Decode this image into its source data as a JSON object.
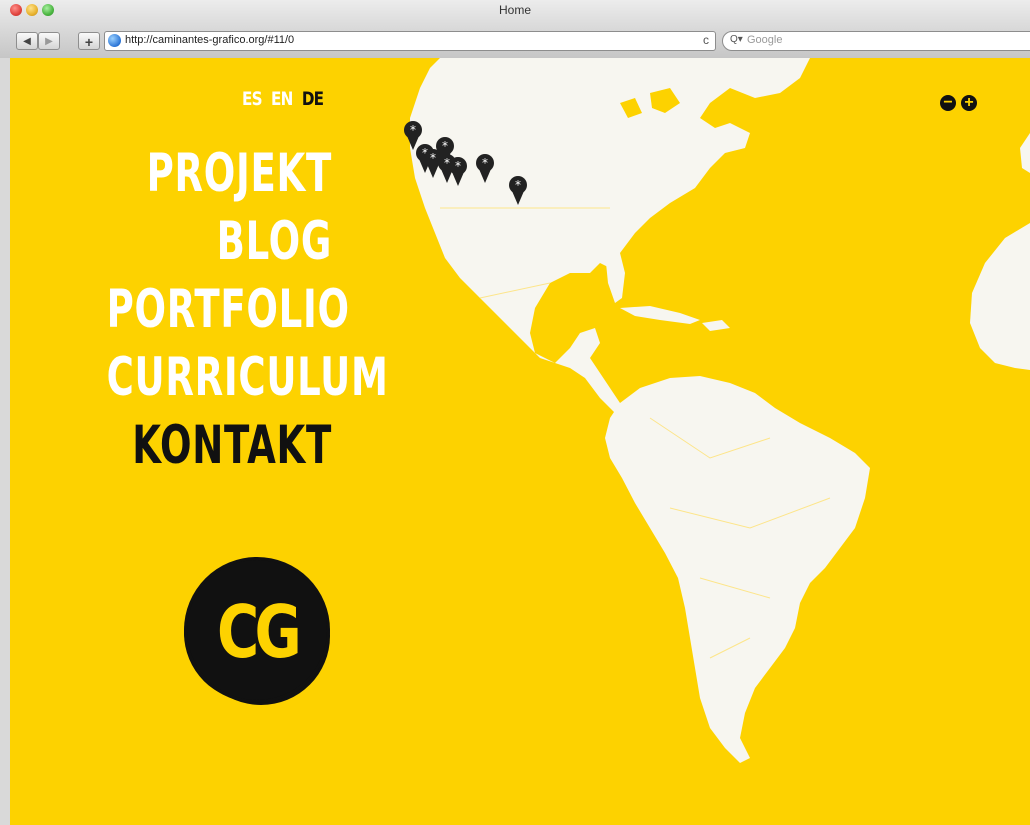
{
  "browser": {
    "window_title": "Home",
    "url": "http://caminantes-grafico.org/#11/0",
    "search_placeholder": "Google",
    "back": "◀",
    "forward": "▶",
    "new_tab": "+",
    "reload": "c"
  },
  "site": {
    "languages": [
      {
        "label": "ES",
        "active": false
      },
      {
        "label": "EN",
        "active": false
      },
      {
        "label": "DE",
        "active": true
      }
    ],
    "menu": [
      {
        "label": "PROJEKT",
        "current": false
      },
      {
        "label": "BLOG",
        "current": false
      },
      {
        "label": "PORTFOLIO",
        "current": false
      },
      {
        "label": "CURRICULUM",
        "current": false
      },
      {
        "label": "KONTAKT",
        "current": true
      }
    ],
    "logo_text": "CG",
    "zoom_out": "−",
    "zoom_in": "+"
  },
  "colors": {
    "background": "#fdd200",
    "land": "#f7f6f0",
    "marker": "#222222",
    "active_text": "#111111"
  },
  "markers_count": 9
}
